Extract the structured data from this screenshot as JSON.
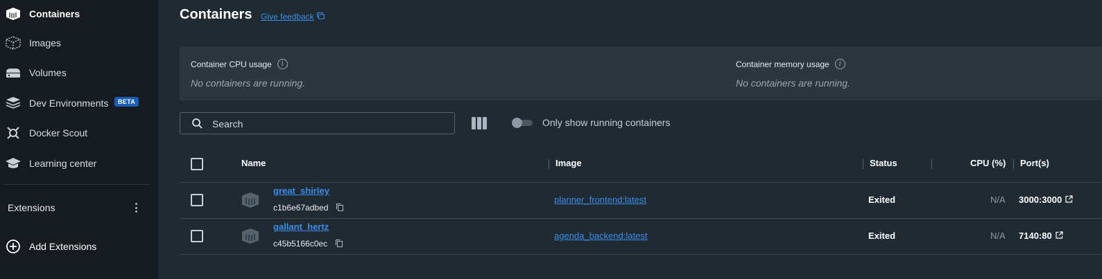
{
  "sidebar": {
    "items": [
      {
        "label": "Containers",
        "icon": "containers-icon",
        "active": true
      },
      {
        "label": "Images",
        "icon": "images-icon"
      },
      {
        "label": "Volumes",
        "icon": "volumes-icon"
      },
      {
        "label": "Dev Environments",
        "icon": "dev-environments-icon",
        "badge": "BETA"
      },
      {
        "label": "Docker Scout",
        "icon": "docker-scout-icon"
      },
      {
        "label": "Learning center",
        "icon": "learning-center-icon"
      }
    ],
    "extensions_label": "Extensions",
    "add_extensions_label": "Add Extensions"
  },
  "main": {
    "title": "Containers",
    "feedback_label": "Give feedback",
    "usage": {
      "cpu_title": "Container CPU usage",
      "memory_title": "Container memory usage",
      "empty_text": "No containers are running."
    },
    "search": {
      "placeholder": "Search"
    },
    "toggle_label": "Only show running containers",
    "table": {
      "columns": [
        "Name",
        "Image",
        "Status",
        "CPU (%)",
        "Port(s)"
      ],
      "rows": [
        {
          "name": "great_shirley",
          "id": "c1b6e67adbed",
          "image": "planner_frontend:latest",
          "status": "Exited",
          "cpu": "N/A",
          "ports": "3000:3000"
        },
        {
          "name": "gallant_hertz",
          "id": "c45b5166c0ec",
          "image": "agenda_backend:latest",
          "status": "Exited",
          "cpu": "N/A",
          "ports": "7140:80"
        }
      ]
    }
  },
  "colors": {
    "background": "#1f2a33",
    "sidebar": "#151b20",
    "panel": "#2b363f",
    "link": "#3b8de8",
    "beta_badge": "#1b5fb5"
  }
}
